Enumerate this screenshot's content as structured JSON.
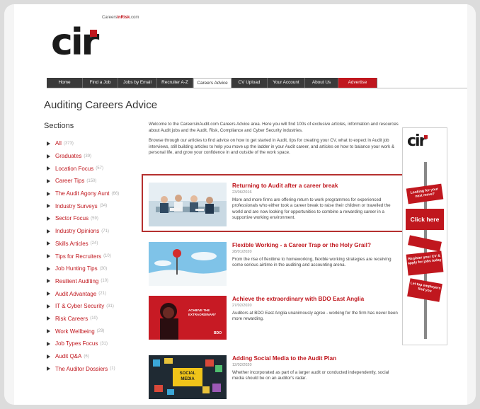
{
  "logo": {
    "mark": "cir",
    "domain_prefix": "Careers",
    "domain_main": "inRisk",
    "domain_suffix": ".com"
  },
  "nav": [
    {
      "label": "Home",
      "w": 0
    },
    {
      "label": "Find a Job"
    },
    {
      "label": "Jobs by Email"
    },
    {
      "label": "Recruiter A-Z"
    },
    {
      "label": "Careers Advice"
    },
    {
      "label": "CV Upload"
    },
    {
      "label": "Your Account"
    },
    {
      "label": "About Us"
    },
    {
      "label": "Advertise"
    }
  ],
  "page_title": "Auditing Careers Advice",
  "sections_title": "Sections",
  "sections": [
    {
      "label": "All",
      "count": "(373)"
    },
    {
      "label": "Graduates",
      "count": "(39)"
    },
    {
      "label": "Location Focus",
      "count": "(57)"
    },
    {
      "label": "Career Tips",
      "count": "(150)"
    },
    {
      "label": "The Audit Agony Aunt",
      "count": "(66)"
    },
    {
      "label": "Industry Surveys",
      "count": "(34)"
    },
    {
      "label": "Sector Focus",
      "count": "(59)"
    },
    {
      "label": "Industry Opinions",
      "count": "(71)"
    },
    {
      "label": "Skills Articles",
      "count": "(24)"
    },
    {
      "label": "Tips for Recruiters",
      "count": "(10)"
    },
    {
      "label": "Job Hunting Tips",
      "count": "(30)"
    },
    {
      "label": "Resilient Auditing",
      "count": "(10)"
    },
    {
      "label": "Audit Advantage",
      "count": "(21)"
    },
    {
      "label": "IT & Cyber Security",
      "count": "(31)"
    },
    {
      "label": "Risk Careers",
      "count": "(10)"
    },
    {
      "label": "Work Wellbeing",
      "count": "(29)"
    },
    {
      "label": "Job Types Focus",
      "count": "(31)"
    },
    {
      "label": "Audit Q&A",
      "count": "(6)"
    },
    {
      "label": "The Auditor Dossiers",
      "count": "(1)"
    }
  ],
  "intro": {
    "p1": "Welcome to the CareersinAudit.com Careers Advice area. Here you will find 100s of exclusive articles, information and resources about Audit jobs and the Audit, Risk, Compliance and Cyber Security industries.",
    "p2": "Browse through our articles to find advice on how to get started in Audit, tips for creating your CV, what to expect in Audit job interviews, still building articles to help you move up the ladder in your Audit career, and articles on how to balance your work & personal life, and grow your confidence in and outside of the work space."
  },
  "articles": [
    {
      "title": "Returning to Audit after a career break",
      "date": "23/06/2016",
      "desc": "More and more firms are offering return to work programmes for experienced professionals who either took a career break to raise their children or travelled the world and are now looking for opportunities to combine a rewarding career in a supportive working environment."
    },
    {
      "title": "Flexible Working - a Career Trap or the Holy Grail?",
      "date": "28/01/2020",
      "desc": "From the rise of flexitime to homeworking, flexible working strategies are receiving some serious airtime in the auditing and accounting arena."
    },
    {
      "title": "Achieve the extraordinary with BDO East Anglia",
      "date": "27/02/2020",
      "desc": "Auditors at BDO East Anglia unanimously agree - working for the firm has never been more rewarding."
    },
    {
      "title": "Adding Social Media to the Audit Plan",
      "date": "12/02/2020",
      "desc": "Whether incorporated as part of a larger audit or conducted independently, social media should be on an auditor's radar."
    }
  ],
  "thumb_text": {
    "bdo": "ACHIEVE THE EXTRAORDINARY",
    "bdo_logo": "BDO",
    "social": "SOCIAL MEDIA"
  },
  "ad": {
    "logo": "cir",
    "sign1": "Looking for your next move?",
    "sign2": "Click here",
    "sign3": "Register your CV & apply for jobs today",
    "sign4": "Let top employers find you"
  },
  "colors": {
    "accent": "#c0171e",
    "nav_dark": "#3a3a3a",
    "highlight_border": "#b5302f"
  }
}
